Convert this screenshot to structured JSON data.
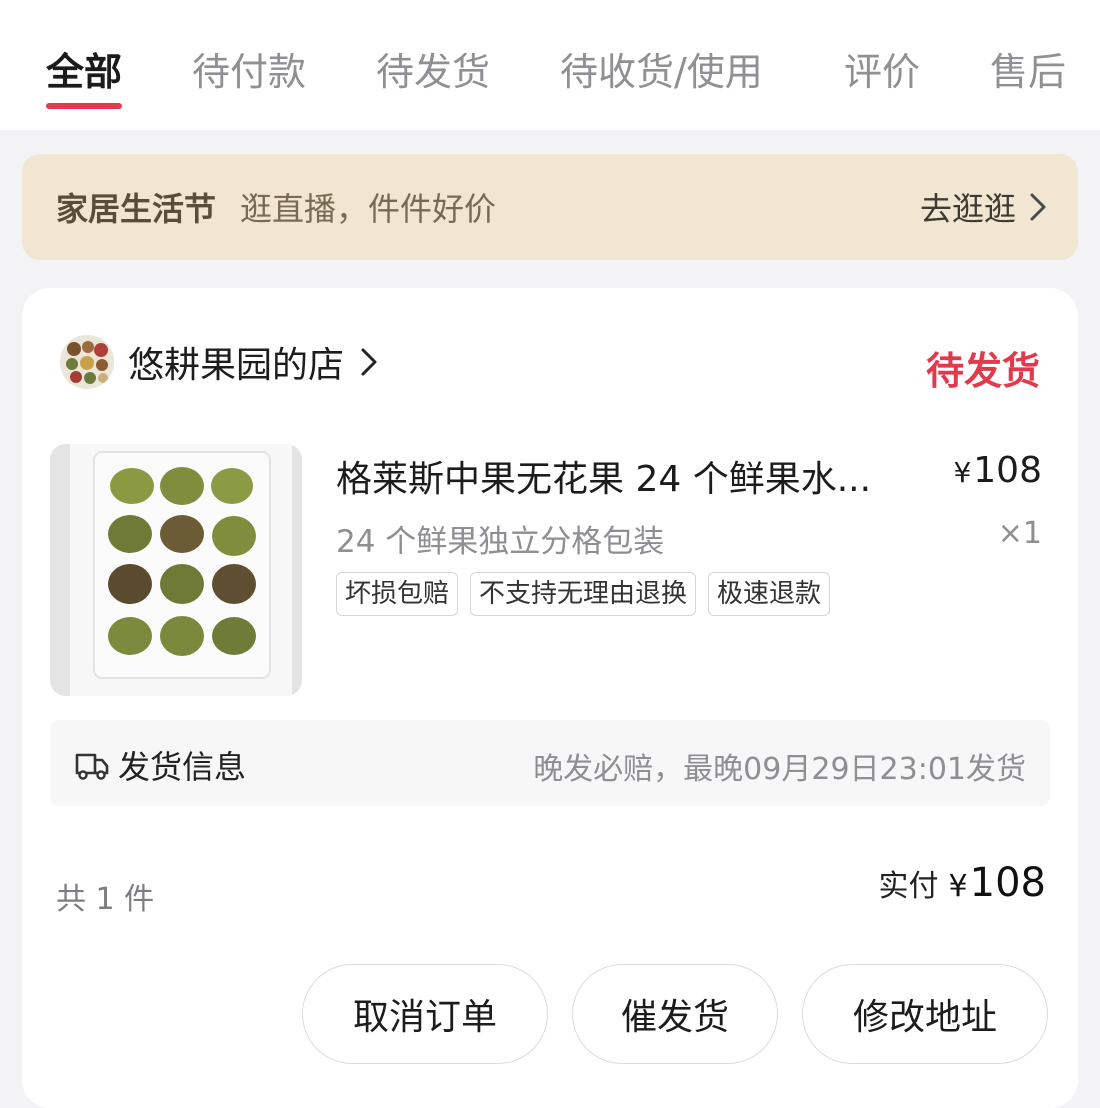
{
  "tabs": [
    {
      "label": "全部",
      "active": true
    },
    {
      "label": "待付款",
      "active": false
    },
    {
      "label": "待发货",
      "active": false
    },
    {
      "label": "待收货/使用",
      "active": false
    },
    {
      "label": "评价",
      "active": false
    },
    {
      "label": "售后",
      "active": false
    }
  ],
  "promo": {
    "title": "家居生活节",
    "subtitle": "逛直播，件件好价",
    "link_label": "去逛逛",
    "link_icon": "chevron-right-icon"
  },
  "order": {
    "shop_name": "悠耕果园的店",
    "shop_icon": "chevron-right-icon",
    "status": "待发货",
    "product": {
      "title": "格莱斯中果无花果 24 个鲜果水...",
      "currency": "¥",
      "price": "108",
      "spec": "24 个鲜果独立分格包装",
      "quantity": "×1",
      "tags": [
        "坏损包赔",
        "不支持无理由退换",
        "极速退款"
      ]
    },
    "shipping": {
      "label": "发货信息",
      "icon": "truck-icon",
      "note": "晚发必赔，最晚09月29日23:01发货"
    },
    "count_text": "共 1 件",
    "paid_label": "实付",
    "paid_currency": "¥",
    "paid_amount": "108",
    "buttons": {
      "cancel": "取消订单",
      "urge": "催发货",
      "address": "修改地址"
    }
  },
  "colors": {
    "accent": "#e5394f",
    "promo_bg": "#f1e6d2",
    "status": "#e13a4c"
  }
}
